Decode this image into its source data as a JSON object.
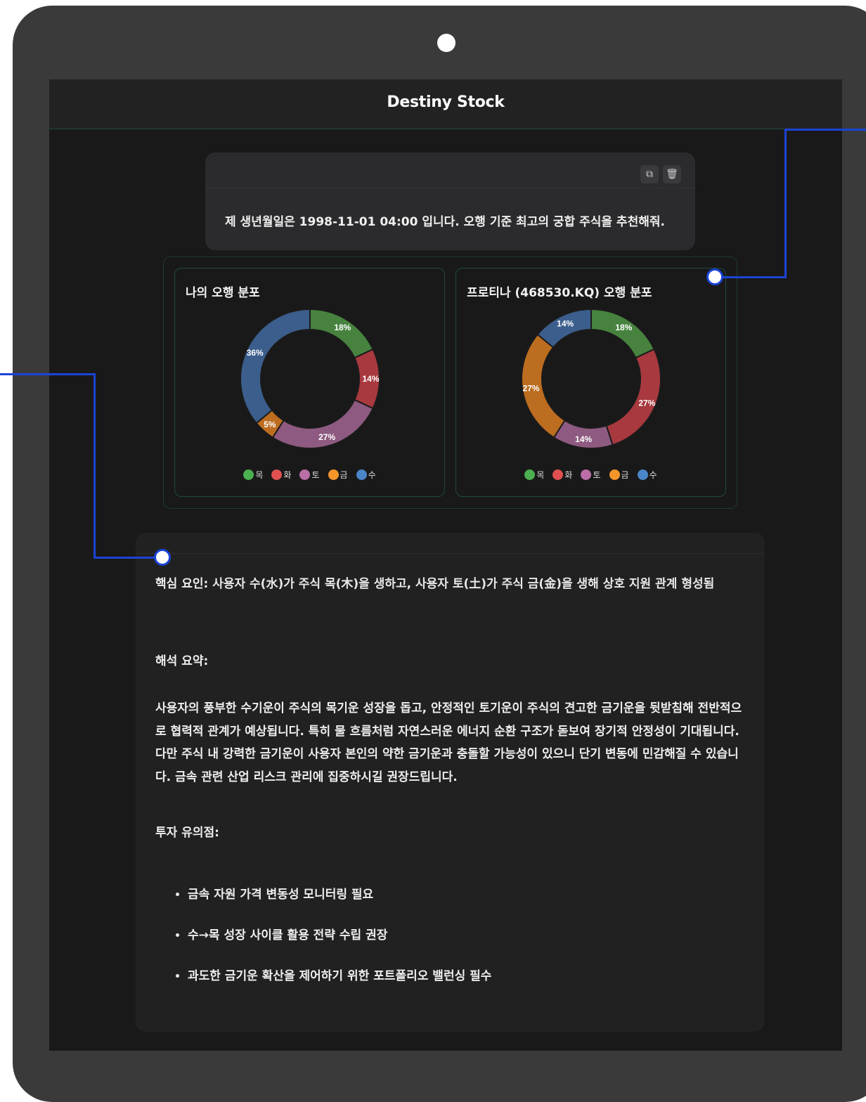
{
  "app": {
    "title": "Destiny Stock"
  },
  "query": {
    "text": "제 생년월일은 1998-11-01 04:00 입니다. 오행 기준 최고의 궁합 주식을 추천해줘.",
    "copy_icon": "copy-icon",
    "delete_icon": "trash-icon"
  },
  "chart_data": [
    {
      "type": "pie",
      "title": "나의 오행 분포",
      "categories": [
        "목",
        "화",
        "토",
        "금",
        "수"
      ],
      "values": [
        18,
        14,
        27,
        5,
        36
      ],
      "labels": [
        "18%",
        "14%",
        "27%",
        "5%",
        "36%"
      ],
      "colors": [
        "#47833f",
        "#a8393f",
        "#8e5a81",
        "#bc6d1f",
        "#3b5e8c"
      ],
      "legend_colors": [
        "#4caf50",
        "#e05050",
        "#b96fa6",
        "#f5962a",
        "#4a86c8"
      ],
      "legend_position": "bottom"
    },
    {
      "type": "pie",
      "title": "프로티나 (468530.KQ) 오행 분포",
      "categories": [
        "목",
        "화",
        "토",
        "금",
        "수"
      ],
      "values": [
        18,
        27,
        14,
        27,
        14
      ],
      "labels": [
        "18%",
        "27%",
        "14%",
        "27%",
        "14%"
      ],
      "colors": [
        "#47833f",
        "#a8393f",
        "#8e5a81",
        "#bc6d1f",
        "#3b5e8c"
      ],
      "legend_colors": [
        "#4caf50",
        "#e05050",
        "#b96fa6",
        "#f5962a",
        "#4a86c8"
      ],
      "legend_position": "bottom"
    }
  ],
  "answer": {
    "key_label": "핵심 요인:",
    "key_text": " 사용자 수(水)가 주식 목(木)을 생하고, 사용자 토(土)가 주식 금(金)을 생해 상호 지원 관계 형성됨",
    "summary_heading": "해석 요약:",
    "summary": "사용자의 풍부한 수기운이 주식의 목기운 성장을 돕고, 안정적인 토기운이 주식의 견고한 금기운을 뒷받침해 전반적으로 협력적 관계가 예상됩니다. 특히 물 흐름처럼 자연스러운 에너지 순환 구조가 돋보여 장기적 안정성이 기대됩니다. 다만 주식 내 강력한 금기운이 사용자 본인의 약한 금기운과 충돌할 가능성이 있으니 단기 변동에 민감해질 수 있습니다. 금속 관련 산업 리스크 관리에 집중하시길 권장드립니다.",
    "caution_heading": "투자 유의점:",
    "bullets": [
      "금속 자원 가격 변동성 모니터링 필요",
      "수→목 성장 사이클 활용 전략 수립 권장",
      "과도한 금기운 확산을 제어하기 위한 포트폴리오 밸런싱 필수"
    ]
  },
  "colors": {
    "callout": "#1a44d6",
    "screen_bg": "#191919",
    "accent_border": "#1f4a44"
  }
}
